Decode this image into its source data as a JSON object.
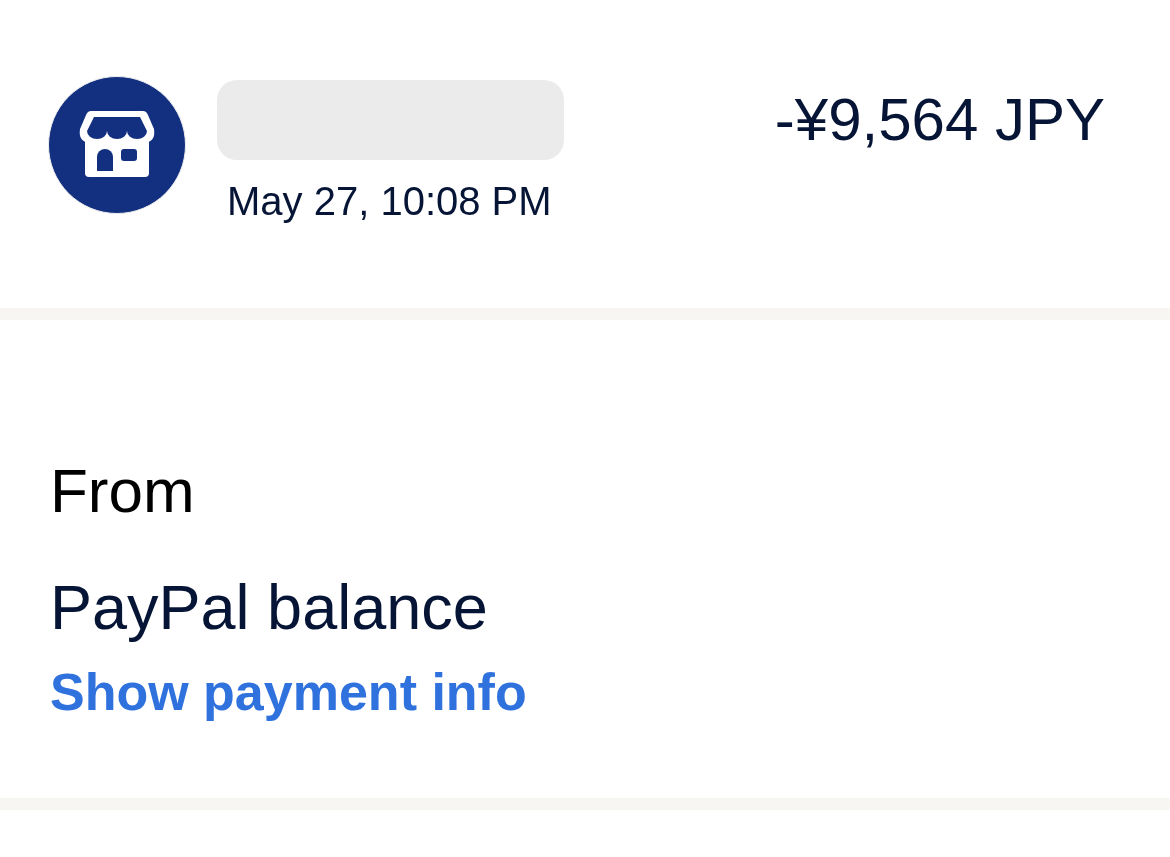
{
  "transaction": {
    "date": "May 27, 10:08 PM",
    "amount": "-¥9,564 JPY"
  },
  "payment": {
    "label": "From",
    "source": "PayPal balance",
    "link": "Show payment info"
  }
}
